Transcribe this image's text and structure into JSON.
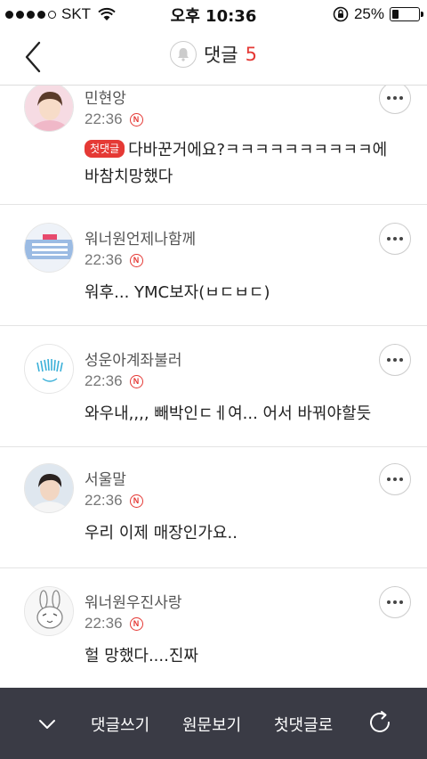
{
  "status_bar": {
    "carrier": "SKT",
    "time": "오후 10:36",
    "battery_percent": "25%",
    "battery_level": 0.25,
    "signal_bars": 4
  },
  "header": {
    "title": "댓글",
    "count": "5"
  },
  "comments": [
    {
      "username": "민현앙",
      "time": "22:36",
      "badge": "첫댓글",
      "text": "다바꾼거에요?ㅋㅋㅋㅋㅋㅋㅋㅋㅋㅋ에 바참치망했다"
    },
    {
      "username": "워너원언제나함께",
      "time": "22:36",
      "text": "워후... YMC보자(ㅂㄷㅂㄷ)"
    },
    {
      "username": "성운아계좌불러",
      "time": "22:36",
      "text": "와우내,,,, 빼박인ㄷㅔ여... 어서 바꿔야할듯"
    },
    {
      "username": "서울말",
      "time": "22:36",
      "text": "우리 이제 매장인가요.."
    },
    {
      "username": "워너원우진사랑",
      "time": "22:36",
      "text": "헐 망했다....진짜"
    }
  ],
  "n_badge": "N",
  "toolbar": {
    "write": "댓글쓰기",
    "view_original": "원문보기",
    "to_first": "첫댓글로"
  },
  "colors": {
    "accent": "#e53935",
    "toolbar_bg": "#3a3b45"
  }
}
